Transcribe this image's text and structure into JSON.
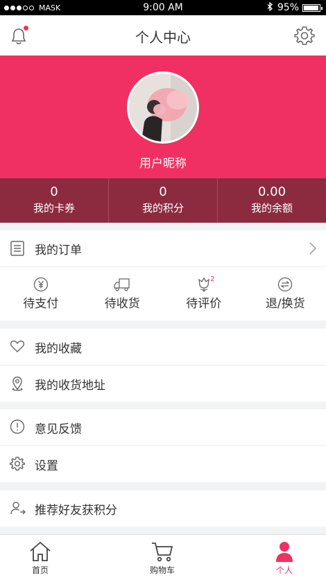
{
  "status_bar": {
    "carrier": "MASK",
    "time": "9:00 AM",
    "battery": "95%"
  },
  "header": {
    "title": "个人中心"
  },
  "profile": {
    "nickname": "用户昵称"
  },
  "stats": [
    {
      "value": "0",
      "label": "我的卡券"
    },
    {
      "value": "0",
      "label": "我的积分"
    },
    {
      "value": "0.00",
      "label": "我的余额"
    }
  ],
  "orders": {
    "label": "我的订单",
    "items": [
      {
        "label": "待支付",
        "icon": "yen-icon"
      },
      {
        "label": "待收货",
        "icon": "truck-icon"
      },
      {
        "label": "待评价",
        "icon": "flower-icon",
        "badge": "2"
      },
      {
        "label": "退/换货",
        "icon": "exchange-icon"
      }
    ]
  },
  "menu": {
    "favorites": "我的收藏",
    "address": "我的收货地址",
    "feedback": "意见反馈",
    "settings": "设置",
    "referral": "推荐好友获积分"
  },
  "tabbar": [
    {
      "label": "首页",
      "icon": "home-icon"
    },
    {
      "label": "购物车",
      "icon": "cart-icon"
    },
    {
      "label": "个人",
      "icon": "person-icon",
      "active": true
    }
  ],
  "colors": {
    "accent": "#f03062",
    "stats_bg": "#8c2a40",
    "page_bg": "#f2f3f5"
  }
}
